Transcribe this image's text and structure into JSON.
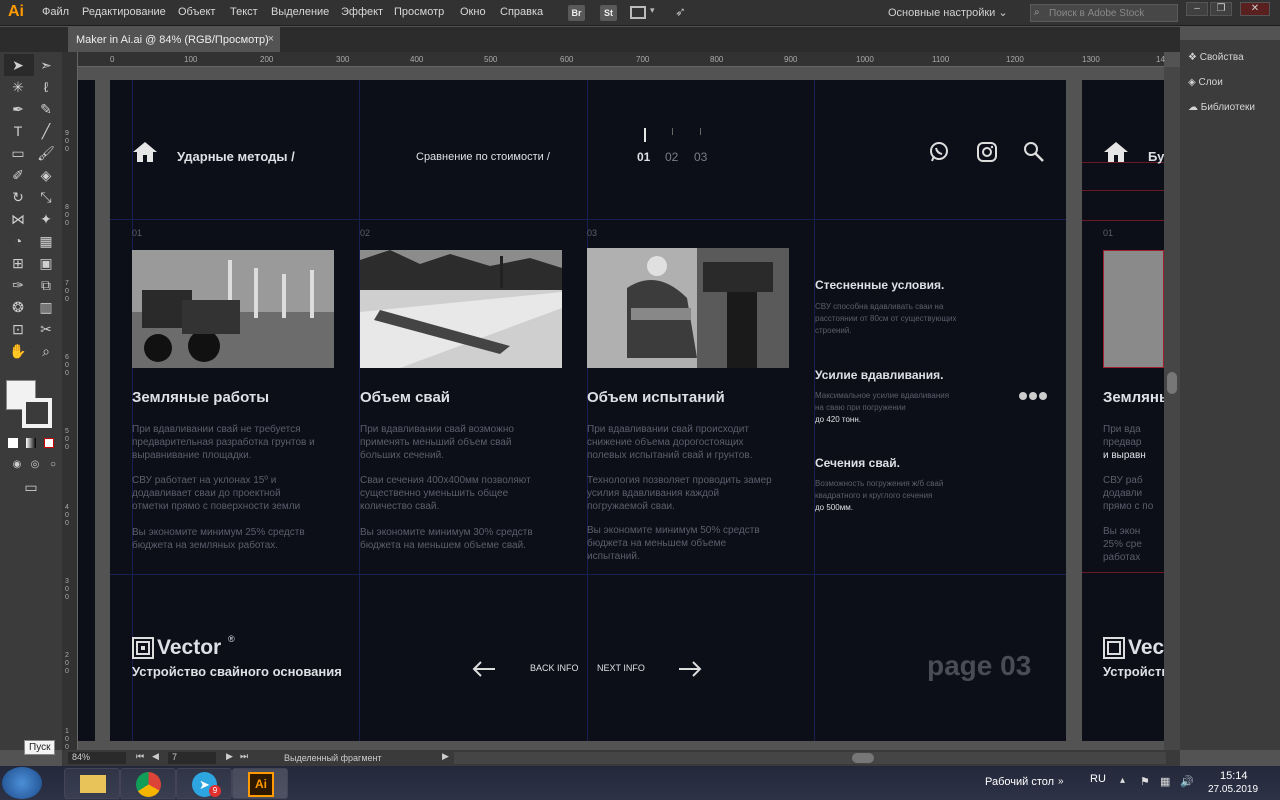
{
  "app": {
    "logo": "Ai",
    "menu": [
      "Файл",
      "Редактирование",
      "Объект",
      "Текст",
      "Выделение",
      "Эффект",
      "Просмотр",
      "Окно",
      "Справка"
    ],
    "badges": [
      "Br",
      "St"
    ],
    "workspace": "Основные настройки",
    "search_placeholder": "Поиск в Adobe Stock"
  },
  "tab": {
    "title": "Maker in Ai.ai @ 84% (RGB/Просмотр)",
    "close": "×"
  },
  "ruler": {
    "top": [
      "0",
      "100",
      "200",
      "300",
      "400",
      "500",
      "600",
      "700",
      "800",
      "900",
      "1000",
      "1100",
      "1200",
      "1300",
      "14"
    ],
    "left": [
      "900",
      "800",
      "700",
      "600",
      "500",
      "400",
      "300",
      "200",
      "100"
    ]
  },
  "panels": [
    {
      "label": "Свойства",
      "icon": "properties-icon"
    },
    {
      "label": "Слои",
      "icon": "layers-icon"
    },
    {
      "label": "Библиотеки",
      "icon": "libraries-icon"
    }
  ],
  "tooltip": "Пуск",
  "artboard": {
    "breadcrumb": "Ударные методы /",
    "compare": "Сравнение по стоимости /",
    "pages": [
      "01",
      "02",
      "03"
    ],
    "columns": [
      {
        "num": "01",
        "title": "Земляные работы",
        "p1": "При вдавливании свай не требуется предварительная разработка грунтов и выравнивание площадки.",
        "p2": "СВУ работает на уклонах 15º и додавливает сваи до проектной отметки прямо с поверхности земли",
        "p3": "Вы экономите минимум 25% средств бюджета на земляных работах."
      },
      {
        "num": "02",
        "title": "Объем свай",
        "p1": "При вдавливании свай возможно применять меньший объем свай больших сечений.",
        "p2": "Сваи сечения 400x400мм позволяют существенно уменьшить общее количество свай.",
        "p3": "Вы экономите минимум 30% средств бюджета на меньшем объеме свай."
      },
      {
        "num": "03",
        "title": "Объем испытаний",
        "p1": "При вдавливании свай происходит снижение объема дорогостоящих полевых испытаний свай и грунтов.",
        "p2": "Технология позволяет проводить замер усилия вдавливания каждой погружаемой сваи.",
        "p3": "Вы экономите минимум 50% средств бюджета на меньшем объеме испытаний."
      }
    ],
    "side": [
      {
        "title": "Стесненные условия.",
        "l1": "СВУ способна вдавливать сваи на",
        "l2": "расстоянии от 80см от существующих",
        "l3": "строений."
      },
      {
        "title": "Усилие вдавливания.",
        "l1": "Максимальное усилие вдавливания",
        "l2": "на сваю при погружении",
        "l3": "до 420 тонн."
      },
      {
        "title": "Сечения свай.",
        "l1": "Возможность погружения ж/б свай",
        "l2": "квадратного и круглого сечения",
        "l3": "до 500мм."
      }
    ],
    "brand": "Vector",
    "brand_mark": "®",
    "subtitle": "Устройство свайного основания",
    "back": "BACK INFO",
    "next": "NEXT INFO",
    "page": "page 03"
  },
  "ghost": {
    "crumb": "Бу",
    "num": "01",
    "title": "Земляны",
    "l1": "При вда",
    "l2": "предвар",
    "l3": "и выравн",
    "l4": "СВУ раб",
    "l5": "додавли",
    "l6": "прямо с по",
    "l7": "Вы экон",
    "l8": "25% сре",
    "l9": "работах",
    "brand": "Vec",
    "sub": "Устройств"
  },
  "status": {
    "zoom": "84%",
    "artboard": "7",
    "selection": "Выделенный фрагмент"
  },
  "taskbar": {
    "desktop": "Рабочий стол",
    "lang": "RU",
    "time": "15:14",
    "date": "27.05.2019",
    "badge": "9"
  },
  "colors": {
    "artboard": "#0c0e18",
    "accent": "#ff9a00",
    "guide": "#1a1f52"
  }
}
